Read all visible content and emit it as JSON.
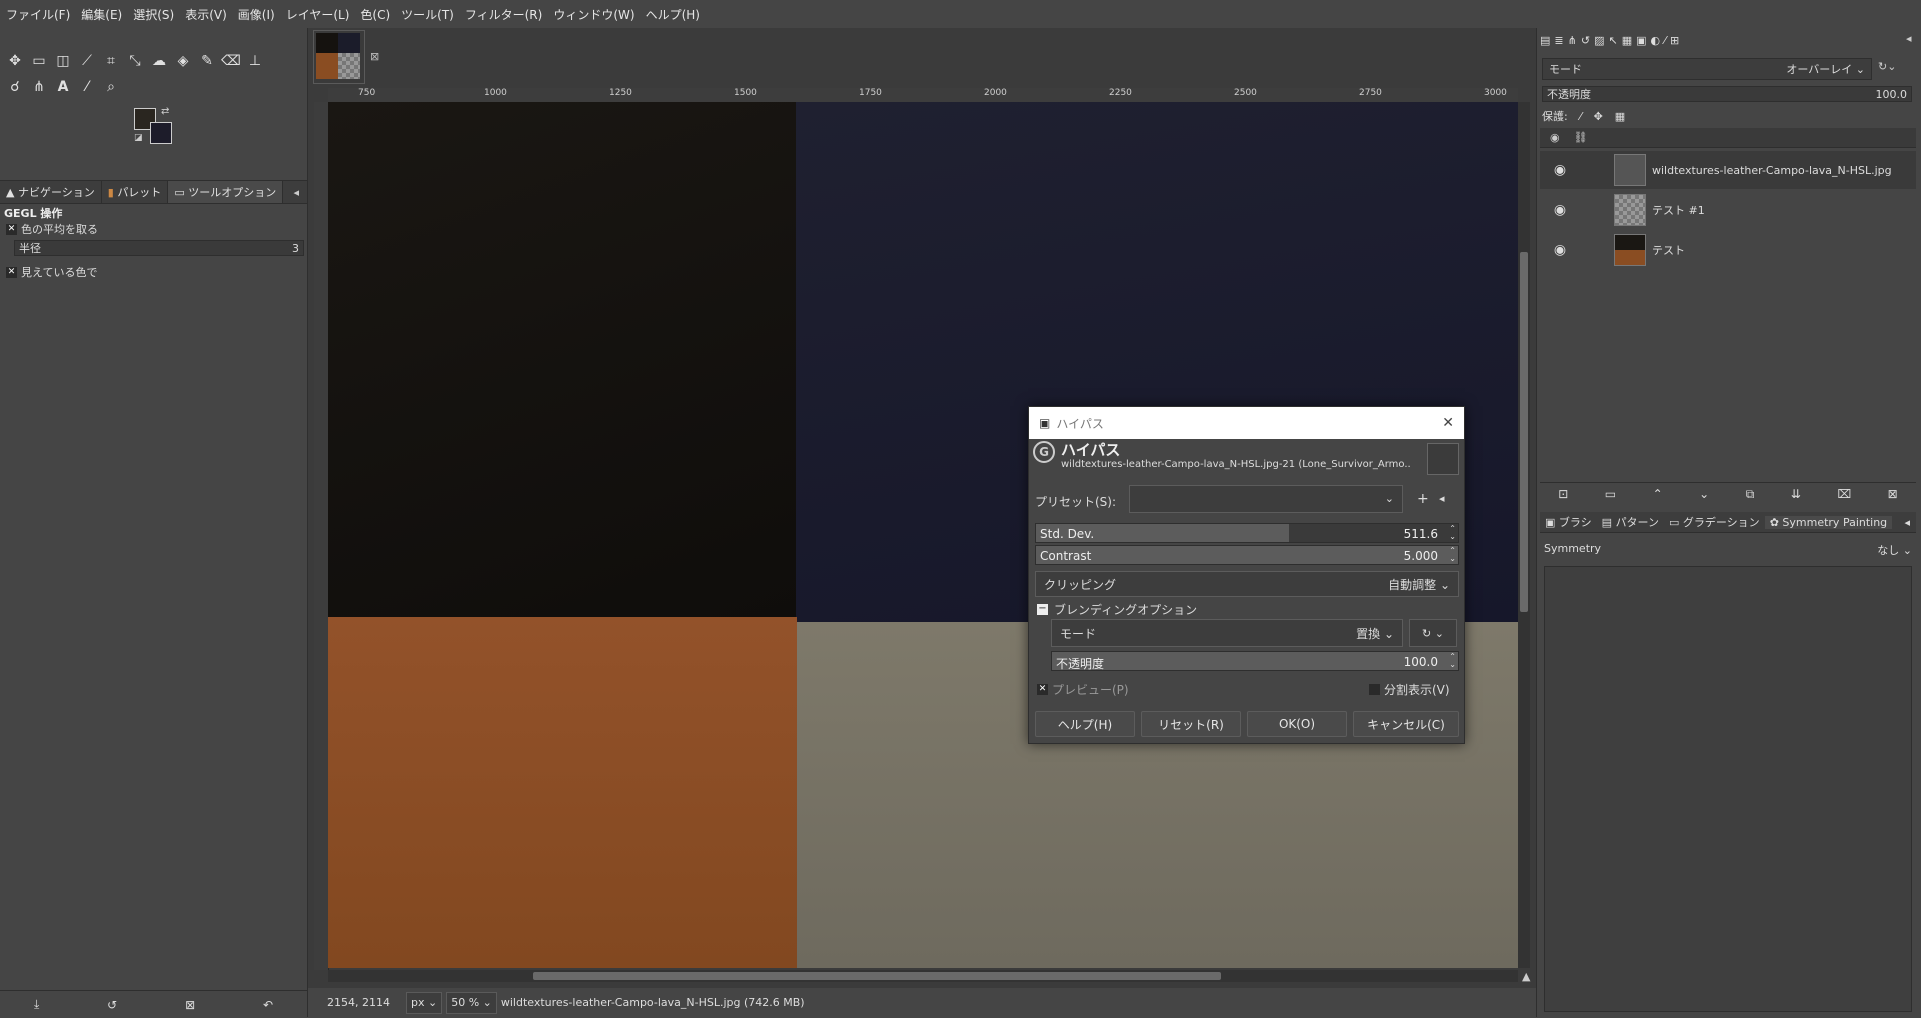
{
  "menu": [
    "ファイル(F)",
    "編集(E)",
    "選択(S)",
    "表示(V)",
    "画像(I)",
    "レイヤー(L)",
    "色(C)",
    "ツール(T)",
    "フィルター(R)",
    "ウィンドウ(W)",
    "ヘルプ(H)"
  ],
  "left": {
    "tabs": [
      "ナビゲーション",
      "パレット",
      "ツールオプション"
    ],
    "panel_title": "GEGL 操作",
    "option1": "色の平均を取る",
    "radius_label": "半径",
    "radius_value": "3",
    "option2": "見えている色で"
  },
  "ruler_h": [
    "750",
    "1000",
    "1250",
    "1500",
    "1750",
    "2000",
    "2250",
    "2500",
    "2750",
    "3000"
  ],
  "status": {
    "coords": "2154, 2114",
    "unit": "px",
    "zoom": "50 %",
    "info": "wildtextures-leather-Campo-lava_N-HSL.jpg (742.6 MB)"
  },
  "layers_panel": {
    "mode_label": "モード",
    "mode_value": "オーバーレイ",
    "opacity_label": "不透明度",
    "opacity_value": "100.0",
    "lock_label": "保護:",
    "layers": [
      {
        "name": "wildtextures-leather-Campo-lava_N-HSL.jpg",
        "active": true
      },
      {
        "name": "テスト #1",
        "active": false
      },
      {
        "name": "テスト",
        "active": false
      }
    ]
  },
  "brush_tabs": [
    "ブラシ",
    "パターン",
    "グラデーション",
    "Symmetry Painting"
  ],
  "symmetry": {
    "label": "Symmetry",
    "value": "なし"
  },
  "dialog": {
    "window_title": "ハイパス",
    "heading": "ハイパス",
    "subtitle": "wildtextures-leather-Campo-lava_N-HSL.jpg-21 (Lone_Survivor_Armo...",
    "preset_label": "プリセット(S):",
    "stddev_label": "Std. Dev.",
    "stddev_value": "511.6",
    "stddev_fraction": 0.6,
    "contrast_label": "Contrast",
    "contrast_value": "5.000",
    "clipping_label": "クリッピング",
    "clipping_value": "自動調整",
    "blend_label": "ブレンディングオプション",
    "mode_label": "モード",
    "mode_value": "置換",
    "opacity_label": "不透明度",
    "opacity_value": "100.0",
    "preview_label": "プレビュー(P)",
    "split_label": "分割表示(V)",
    "btn_help": "ヘルプ(H)",
    "btn_reset": "リセット(R)",
    "btn_ok": "OK(O)",
    "btn_cancel": "キャンセル(C)"
  },
  "colors": {
    "fg": "#2a2620",
    "bg": "#1d1c2a",
    "tex_dark": "#15120f",
    "tex_navy": "#1b1c2a",
    "tex_orange": "#8a4d22",
    "tex_gray": "#7a7566"
  }
}
